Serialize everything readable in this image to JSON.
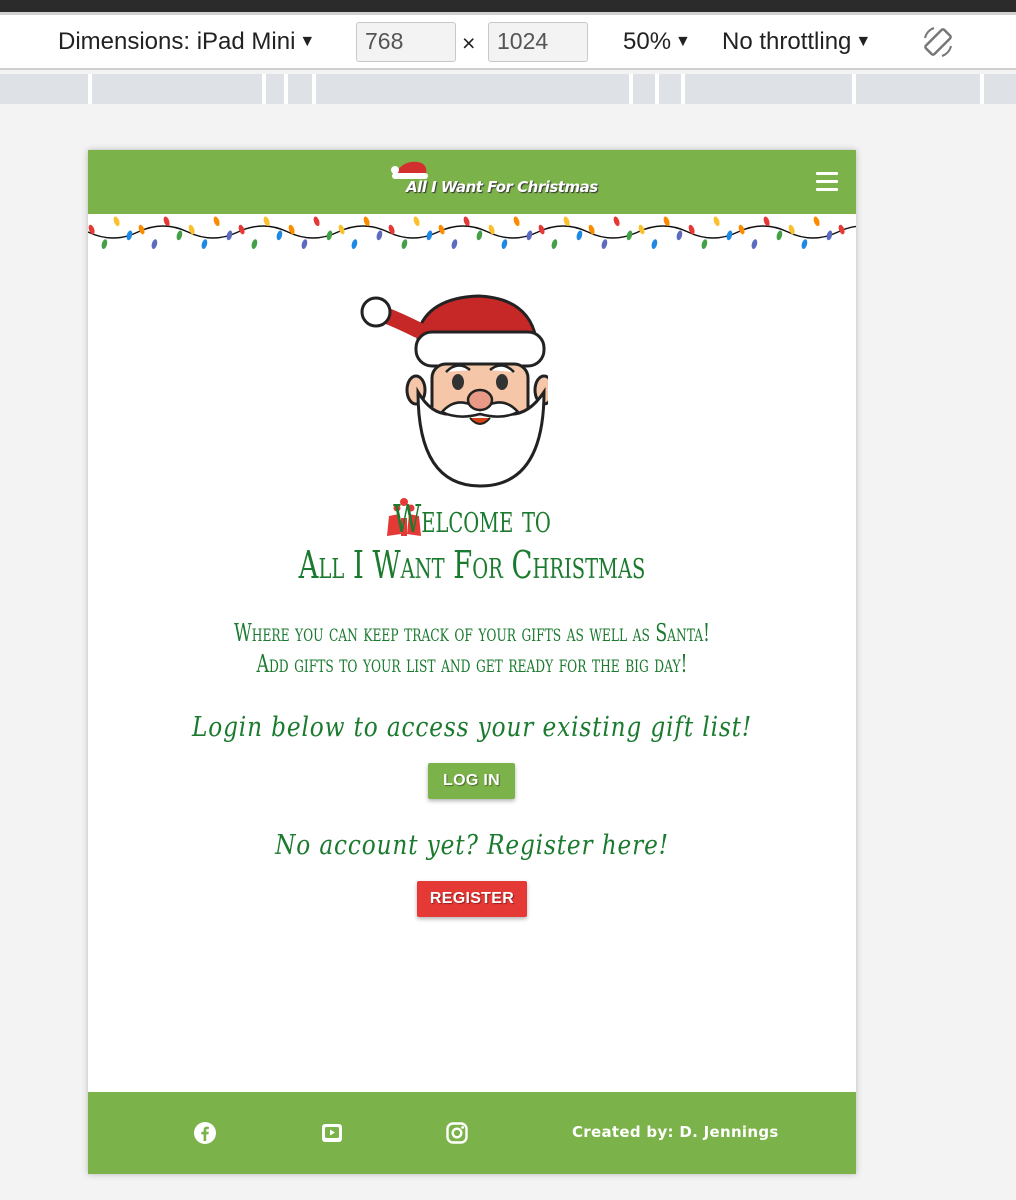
{
  "devtools": {
    "dimensions_label": "Dimensions: iPad Mini",
    "width_value": "768",
    "height_value": "1024",
    "times_sign": "×",
    "zoom_label": "50%",
    "throttling_label": "No throttling"
  },
  "nav": {
    "brand_text": "All I Want For Christmas",
    "menu_icon": "hamburger-menu-icon"
  },
  "hero": {
    "welcome_line1": "Welcome to",
    "welcome_line2": "All I Want For Christmas",
    "intro_line1": "Where you can keep track of your gifts as well as Santa!",
    "intro_line2": "Add gifts to your list and get ready for the big day!"
  },
  "auth": {
    "login_prompt": "Login below to access your existing gift list!",
    "login_button": "LOG IN",
    "register_prompt": "No account yet? Register here!",
    "register_button": "REGISTER"
  },
  "footer": {
    "icons": [
      "facebook-icon",
      "youtube-icon",
      "instagram-icon"
    ],
    "credit": "Created by: D. Jennings"
  },
  "colors": {
    "brand_green": "#7cb24a",
    "text_green": "#1a7a2e",
    "register_red": "#e53935"
  }
}
